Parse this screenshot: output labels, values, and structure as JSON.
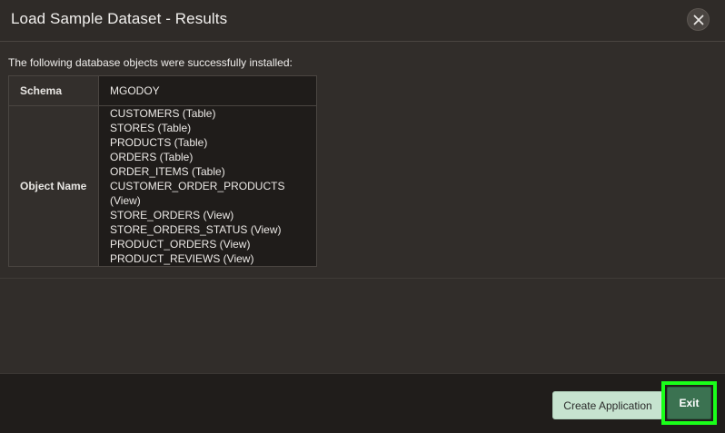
{
  "dialog": {
    "title": "Load Sample Dataset - Results",
    "close_icon": "close-icon"
  },
  "body": {
    "intro": "The following database objects were successfully installed:",
    "table": {
      "schema_label": "Schema",
      "schema_value": "MGODOY",
      "object_label": "Object Name",
      "objects": [
        "CUSTOMERS (Table)",
        "STORES (Table)",
        "PRODUCTS (Table)",
        "ORDERS (Table)",
        "ORDER_ITEMS (Table)",
        "CUSTOMER_ORDER_PRODUCTS (View)",
        "STORE_ORDERS (View)",
        "STORE_ORDERS_STATUS (View)",
        "PRODUCT_ORDERS (View)",
        "PRODUCT_REVIEWS (View)"
      ]
    }
  },
  "footer": {
    "create_label": "Create Application",
    "exit_label": "Exit"
  },
  "colors": {
    "background": "#312d2a",
    "footer": "#201d1b",
    "create_button": "#c6e3cf",
    "exit_button": "#3b7251",
    "highlight": "#1aff1a"
  }
}
